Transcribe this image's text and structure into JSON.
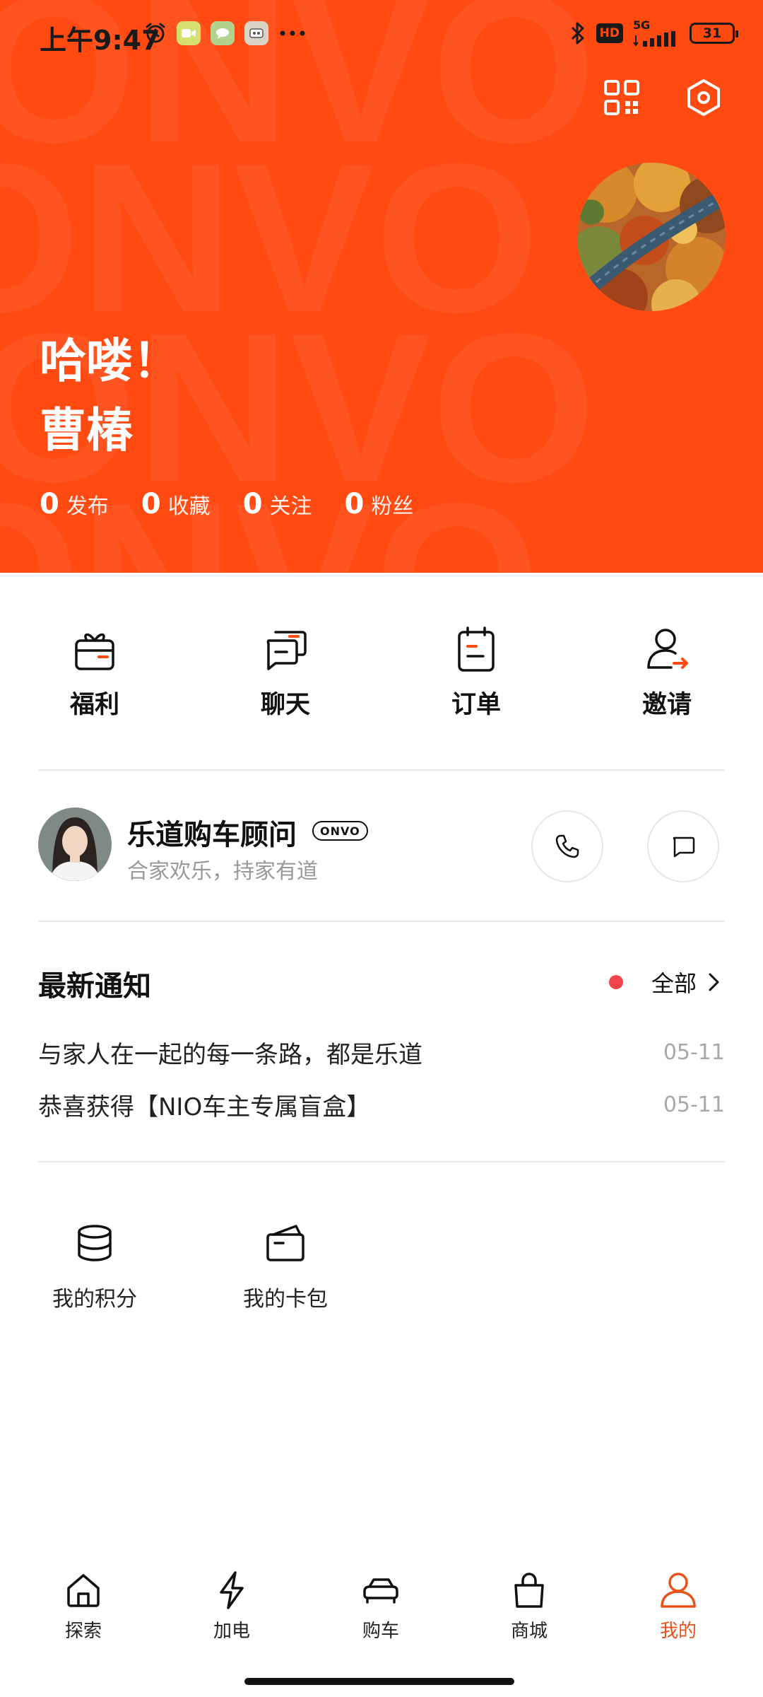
{
  "status_bar": {
    "time": "上午9:47",
    "network": "5G",
    "battery": "31"
  },
  "header": {
    "greeting": "哈喽！",
    "username": "曹椿",
    "watermark_text": "ONVO",
    "stats": [
      {
        "count": "0",
        "label": "发布"
      },
      {
        "count": "0",
        "label": "收藏"
      },
      {
        "count": "0",
        "label": "关注"
      },
      {
        "count": "0",
        "label": "粉丝"
      }
    ]
  },
  "quick_actions": [
    {
      "label": "福利",
      "icon": "gift-icon"
    },
    {
      "label": "聊天",
      "icon": "chat-icon"
    },
    {
      "label": "订单",
      "icon": "order-icon"
    },
    {
      "label": "邀请",
      "icon": "invite-icon"
    }
  ],
  "advisor": {
    "name": "乐道购车顾问",
    "badge": "ONVO",
    "subtitle": "合家欢乐，持家有道"
  },
  "notifications": {
    "title": "最新通知",
    "view_all": "全部",
    "items": [
      {
        "text": "与家人在一起的每一条路，都是乐道",
        "date": "05-11"
      },
      {
        "text": "恭喜获得【NIO车主专属盲盒】",
        "date": "05-11"
      }
    ]
  },
  "tools": [
    {
      "label": "我的积分",
      "icon": "points-icon"
    },
    {
      "label": "我的卡包",
      "icon": "wallet-icon"
    }
  ],
  "bottom_nav": [
    {
      "label": "探索",
      "icon": "home-icon"
    },
    {
      "label": "加电",
      "icon": "lightning-icon"
    },
    {
      "label": "购车",
      "icon": "car-icon"
    },
    {
      "label": "商城",
      "icon": "shopping-bag-icon"
    },
    {
      "label": "我的",
      "icon": "person-icon",
      "active": true
    }
  ],
  "colors": {
    "brand": "#ff4a12",
    "active_tab": "#e8531c",
    "notification_dot": "#f0444b"
  }
}
